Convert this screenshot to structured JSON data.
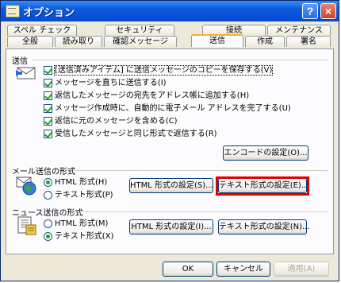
{
  "window": {
    "title": "オプション",
    "help_label": "?",
    "close_label": "×"
  },
  "tabs_top": [
    {
      "label": "スペル チェック"
    },
    {
      "label": "セキュリティ"
    },
    {
      "label": "接続"
    },
    {
      "label": "メンテナンス"
    }
  ],
  "tabs_bottom": [
    {
      "label": "全般"
    },
    {
      "label": "読み取り"
    },
    {
      "label": "確認メッセージ"
    },
    {
      "label": "送信",
      "active": true
    },
    {
      "label": "作成"
    },
    {
      "label": "署名"
    }
  ],
  "send": {
    "label": "送信",
    "options": [
      {
        "label": "[送信済みアイテム] に送信メッセージのコピーを保存する(V)",
        "checked": true
      },
      {
        "label": "メッセージを直ちに送信する(I)",
        "checked": true
      },
      {
        "label": "返信したメッセージの宛先をアドレス帳に追加する(H)",
        "checked": true
      },
      {
        "label": "メッセージ作成時に、自動的に電子メール アドレスを完了する(U)",
        "checked": true
      },
      {
        "label": "返信に元のメッセージを含める(C)",
        "checked": true
      },
      {
        "label": "受信したメッセージと同じ形式で返信する(R)",
        "checked": true
      }
    ],
    "encode_button": "エンコードの設定(O)..."
  },
  "mail_format": {
    "label": "メール送信の形式",
    "html_radio": "HTML 形式(H)",
    "text_radio": "テキスト形式(P)",
    "selected": "html",
    "html_settings_button": "HTML 形式の設定(S)...",
    "text_settings_button": "テキスト形式の設定(E)..."
  },
  "news_format": {
    "label": "ニュース送信の形式",
    "html_radio": "HTML 形式(M)",
    "text_radio": "テキスト形式(X)",
    "selected": "text",
    "html_settings_button": "HTML 形式の設定(I)...",
    "text_settings_button": "テキスト形式の設定(N)..."
  },
  "footer": {
    "ok": "OK",
    "cancel": "キャンセル",
    "apply": "適用(A)"
  }
}
